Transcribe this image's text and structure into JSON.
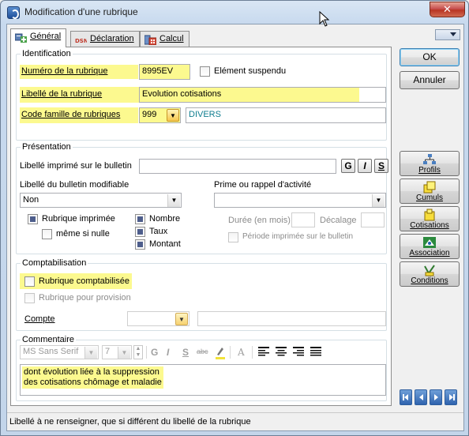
{
  "window": {
    "title": "Modification d'une rubrique",
    "close_glyph": "✕"
  },
  "tabs": [
    {
      "label": "Général",
      "icon": "general-icon",
      "active": true
    },
    {
      "label": "Déclaration",
      "icon": "dsn-icon",
      "active": false
    },
    {
      "label": "Calcul",
      "icon": "calculator-icon",
      "active": false
    }
  ],
  "identification": {
    "title": "Identification",
    "numero_label": "Numéro de la rubrique",
    "numero_value": "8995EV",
    "suspendu_label": "Elément suspendu",
    "libelle_label": "Libellé de la rubrique",
    "libelle_value": "Evolution cotisations",
    "famille_label": "Code famille de rubriques",
    "famille_code": "999",
    "famille_name": "DIVERS"
  },
  "presentation": {
    "title": "Présentation",
    "libelle_imprime_label": "Libellé imprimé sur le bulletin",
    "libelle_imprime_value": "",
    "fmt_bold": "G",
    "fmt_italic": "I",
    "fmt_underline": "S",
    "libelle_modifiable_label": "Libellé du bulletin modifiable",
    "libelle_modifiable_value": "Non",
    "prime_label": "Prime ou rappel d'activité",
    "prime_value": "",
    "rubrique_imprimee_label": "Rubrique imprimée",
    "meme_si_nulle_label": "même si nulle",
    "nombre_label": "Nombre",
    "taux_label": "Taux",
    "montant_label": "Montant",
    "duree_label": "Durée (en mois)",
    "decalage_label": "Décalage",
    "periode_label": "Période imprimée sur le bulletin"
  },
  "comptabilisation": {
    "title": "Comptabilisation",
    "comptabilisee_label": "Rubrique comptabilisée",
    "provision_label": "Rubrique pour provision",
    "compte_label": "Compte",
    "compte_value": "",
    "compte_text": ""
  },
  "commentaire": {
    "title": "Commentaire",
    "font_name": "MS Sans Serif",
    "font_size": "7",
    "tb_bold": "G",
    "tb_italic": "I",
    "tb_underline": "S",
    "tb_strike": "abc",
    "tb_font": "A",
    "text_line1": "dont évolution liée à la suppression",
    "text_line2": "des cotisations chômage et maladie"
  },
  "buttons": {
    "ok": "OK",
    "annuler": "Annuler"
  },
  "side_buttons": [
    {
      "label": "Profils",
      "icon": "profiles-icon"
    },
    {
      "label": "Cumuls",
      "icon": "cumuls-icon"
    },
    {
      "label": "Cotisations",
      "icon": "cotisations-icon"
    },
    {
      "label": "Association",
      "icon": "association-icon"
    },
    {
      "label": "Conditions",
      "icon": "conditions-icon"
    }
  ],
  "status_text": "Libellé à ne renseigner, que si différent du libellé de la rubrique",
  "colors": {
    "highlight": "#fcf98f",
    "teal_text": "#0f7d8f"
  }
}
